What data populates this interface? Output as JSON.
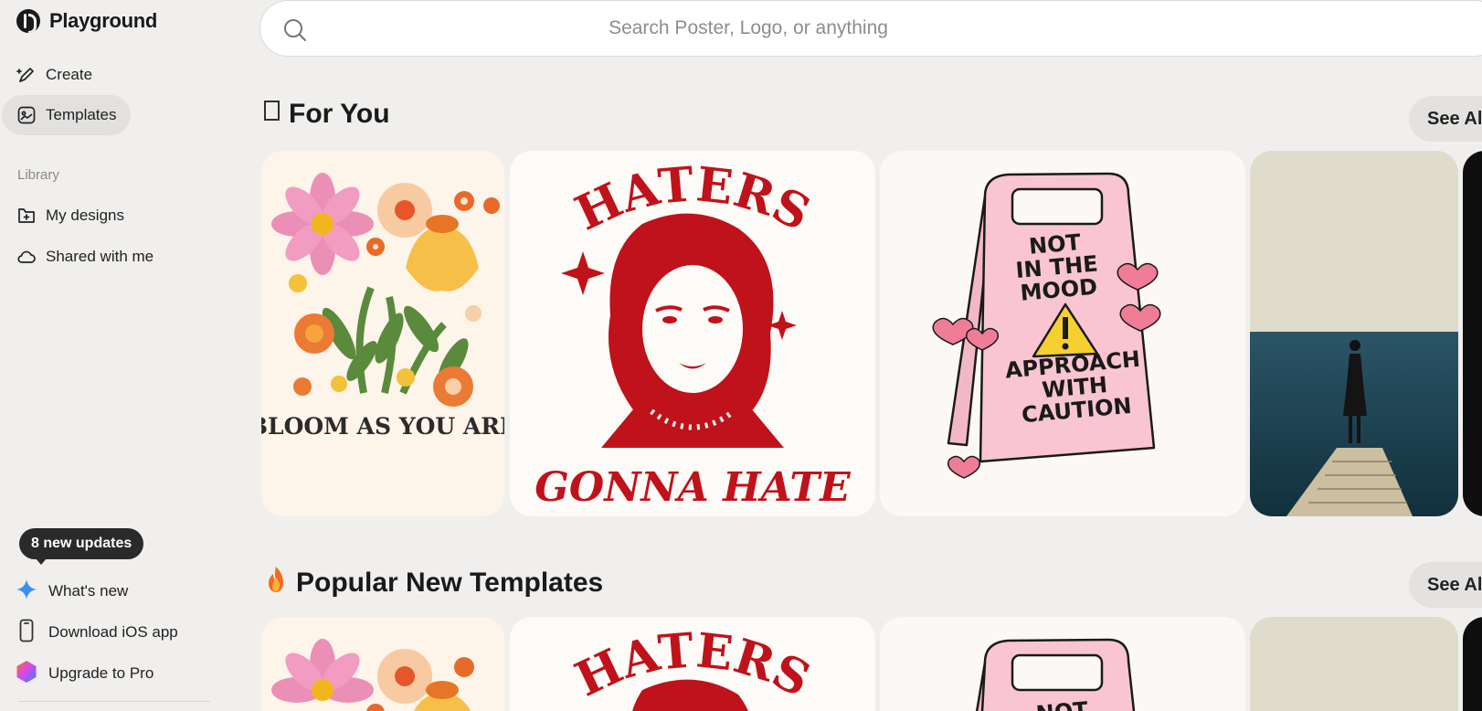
{
  "app": {
    "name": "Playground"
  },
  "nav": {
    "create": "Create",
    "templates": "Templates",
    "library_label": "Library",
    "my_designs": "My designs",
    "shared": "Shared with me"
  },
  "bottom": {
    "updates_badge": "8 new updates",
    "whats_new": "What's new",
    "download_ios": "Download iOS app",
    "upgrade": "Upgrade to Pro"
  },
  "search": {
    "placeholder": "Search Poster, Logo, or anything"
  },
  "sections": [
    {
      "icon": "square-glyph-icon",
      "title": "For You",
      "see_all": "See All"
    },
    {
      "icon": "fire-icon",
      "title": "Popular New Templates",
      "see_all": "See All"
    }
  ],
  "cards": {
    "bloom": {
      "text": "BLOOM AS YOU ARE"
    },
    "haters": {
      "top": "HATERS",
      "bottom": "GONNA HATE"
    },
    "caution": {
      "lines": [
        "NOT",
        "IN THE",
        "MOOD",
        "APPROACH",
        "WITH",
        "CAUTION"
      ]
    }
  },
  "colors": {
    "accent_red": "#c0121a",
    "sign_pink": "#f9c5d3",
    "sea": "#1f4a5c",
    "sidebar_active": "#e2e1df"
  }
}
